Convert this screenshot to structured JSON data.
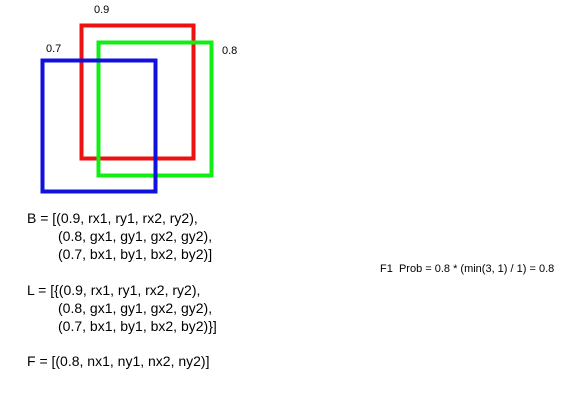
{
  "boxes": [
    {
      "label": "0.9",
      "color": "#ee1111"
    },
    {
      "label": "0.8",
      "color": "#11ee11"
    },
    {
      "label": "0.7",
      "color": "#1111dd"
    }
  ],
  "code": {
    "b": [
      "B = [(0.9, rx1, ry1, rx2, ry2),",
      "(0.8, gx1, gy1, gx2, gy2),",
      "(0.7, bx1, by1, bx2, by2)]"
    ],
    "l": [
      "L = [{(0.9, rx1, ry1, rx2, ry2),",
      "(0.8, gx1, gy1, gx2, gy2),",
      "(0.7, bx1, by1, bx2, by2)}]"
    ],
    "f": [
      "F = [(0.8, nx1, ny1, nx2, ny2)]"
    ]
  },
  "formula": "F1  Prob = 0.8 * (min(3, 1) / 1) = 0.8"
}
